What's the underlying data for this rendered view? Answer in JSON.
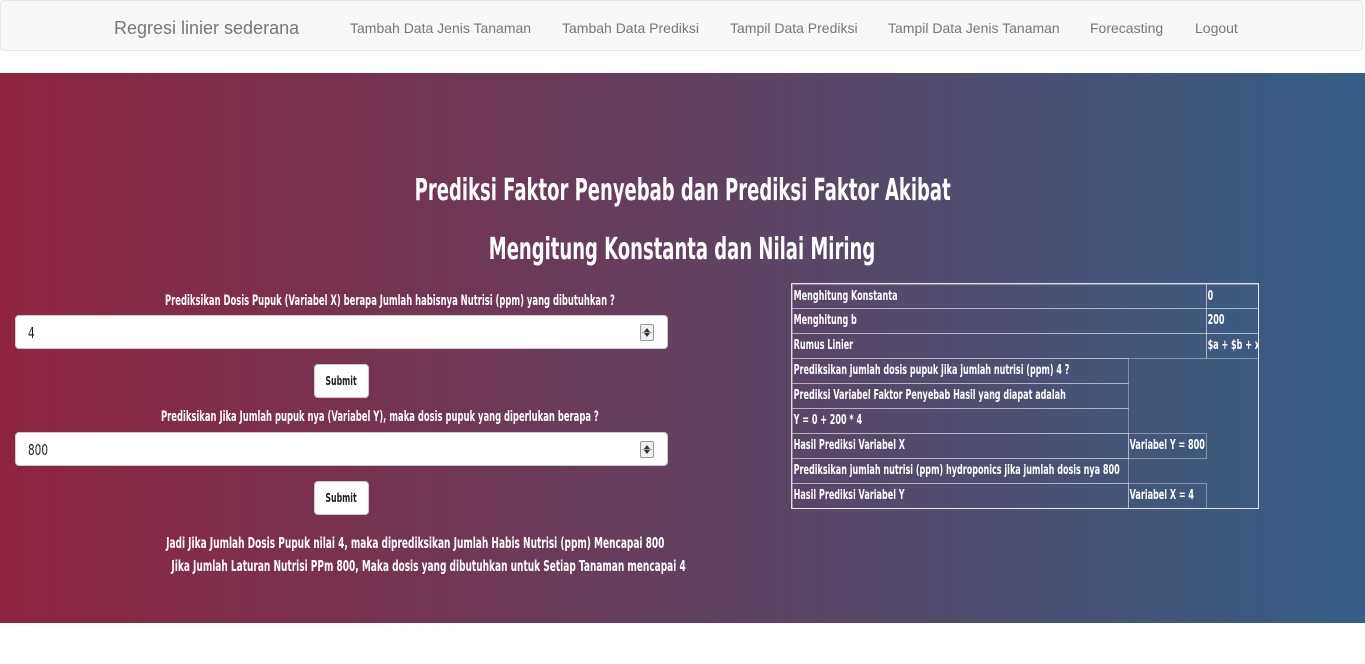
{
  "navbar": {
    "brand": "Regresi linier sederana",
    "items": [
      {
        "label": "Tambah Data Jenis Tanaman"
      },
      {
        "label": "Tambah Data Prediksi"
      },
      {
        "label": "Tampil Data Prediksi"
      },
      {
        "label": "Tampil Data Jenis Tanaman"
      },
      {
        "label": "Forecasting"
      },
      {
        "label": "Logout"
      }
    ]
  },
  "hero": {
    "title1": "Prediksi Faktor Penyebab dan Prediksi Faktor Akibat",
    "title2": "Mengitung Konstanta dan Nilai Miring",
    "colors": {
      "gradient_start": "#8e2440",
      "gradient_end": "#355f87"
    }
  },
  "form1": {
    "label": "Prediksikan Dosis Pupuk (Variabel X) berapa Jumlah habisnya Nutrisi (ppm) yang dibutuhkan ?",
    "value": "4",
    "submit_label": "Submit"
  },
  "form2": {
    "label": "Prediksikan Jika Jumlah pupuk nya (Variabel Y), maka dosis pupuk yang diperlukan berapa ?",
    "value": "800",
    "submit_label": "Submit"
  },
  "result": {
    "line1": "Jadi Jika Jumlah Dosis Pupuk nilai 4, maka diprediksikan Jumlah Habis Nutrisi (ppm) Mencapai 800",
    "line2": "Jika Jumlah Laturan Nutrisi PPm 800, Maka dosis yang dibutuhkan untuk Setiap Tanaman mencapai 4"
  },
  "table": {
    "r1": {
      "label": "Menghitung Konstanta",
      "value": "0"
    },
    "r2": {
      "label": "Menghitung b",
      "value": "200"
    },
    "r3": {
      "label": "Rumus Linier",
      "value": "$a + $b + x"
    },
    "r4": {
      "label": "Prediksikan jumlah dosis pupuk jika jumlah nutrisi (ppm) 4 ?"
    },
    "r5": {
      "label": "Prediksi Variabel Faktor Penyebab Hasil yang diapat adalah"
    },
    "r6": {
      "label": "Y = 0 + 200 * 4"
    },
    "r7": {
      "label": "Hasil Prediksi Variabel X",
      "value": "Variabel Y = 800"
    },
    "r8": {
      "label": "Prediksikan jumlah nutrisi (ppm) hydroponics jika jumlah dosis nya 800"
    },
    "r9": {
      "label": "Hasil Prediksi Variabel Y",
      "value": "Variabel X = 4"
    }
  }
}
